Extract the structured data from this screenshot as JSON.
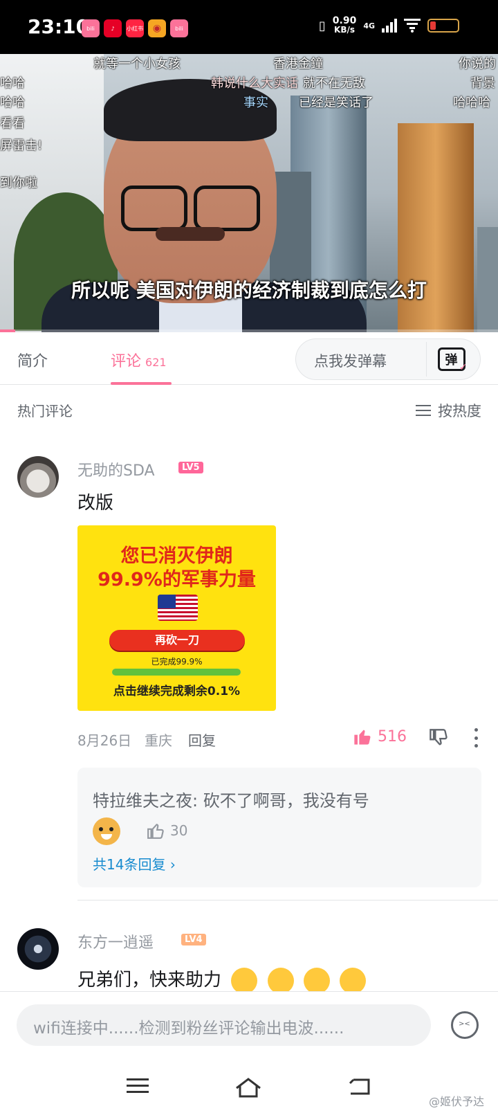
{
  "status_bar": {
    "time": "23:10",
    "app_icons": [
      "bilibili-icon",
      "netease-music-icon",
      "xiaohongshu-icon",
      "weibo-icon",
      "bilibili-icon"
    ],
    "net_speed_value": "0.90",
    "net_speed_unit": "KB/s",
    "network": "4G",
    "battery_color": "#e53935"
  },
  "video": {
    "subtitle": "所以呢 美国对伊朗的经济制裁到底怎么打",
    "danmaku": [
      "就等一个小女孩",
      "香港金鐘",
      "你说的",
      "哈哈",
      "韩说什么大实话",
      "就不在无敌",
      "背景",
      "哈哈",
      "事实",
      "已经是笑话了",
      "哈哈哈",
      "看看",
      "屏雷击!",
      "到你啦"
    ],
    "progress": 0.03
  },
  "tabs": {
    "intro": "简介",
    "comments": "评论",
    "comments_count": "621",
    "danmaku_placeholder": "点我发弹幕",
    "danmaku_button": "弹"
  },
  "comments_section": {
    "title": "热门评论",
    "sort_label": "按热度"
  },
  "comments": [
    {
      "username": "无助的SDA",
      "level": "LV5",
      "level_color": "#ff6699",
      "text": "改版",
      "image": {
        "title_line1": "您已消灭伊朗",
        "title_line2": "99.9%的军事力量",
        "button": "再砍一刀",
        "done": "已完成99.9%",
        "progress": 0.999,
        "remain": "点击继续完成剩余0.1%"
      },
      "date": "8月26日",
      "location": "重庆",
      "reply_label": "回复",
      "likes": "516",
      "liked": true,
      "sub_reply": {
        "author": "特拉维夫之夜",
        "text": "砍不了啊哥，我没有号",
        "likes": "30",
        "more_label": "共14条回复"
      }
    },
    {
      "username": "东方一逍遥",
      "level": "LV4",
      "level_color": "#ffb27f",
      "text": "兄弟们，快来助力"
    }
  ],
  "bottom_bar": {
    "input_placeholder": "wifi连接中......检测到粉丝评论输出电波......"
  },
  "watermark": "@姬伏予达",
  "accent_color": "#fb7299"
}
